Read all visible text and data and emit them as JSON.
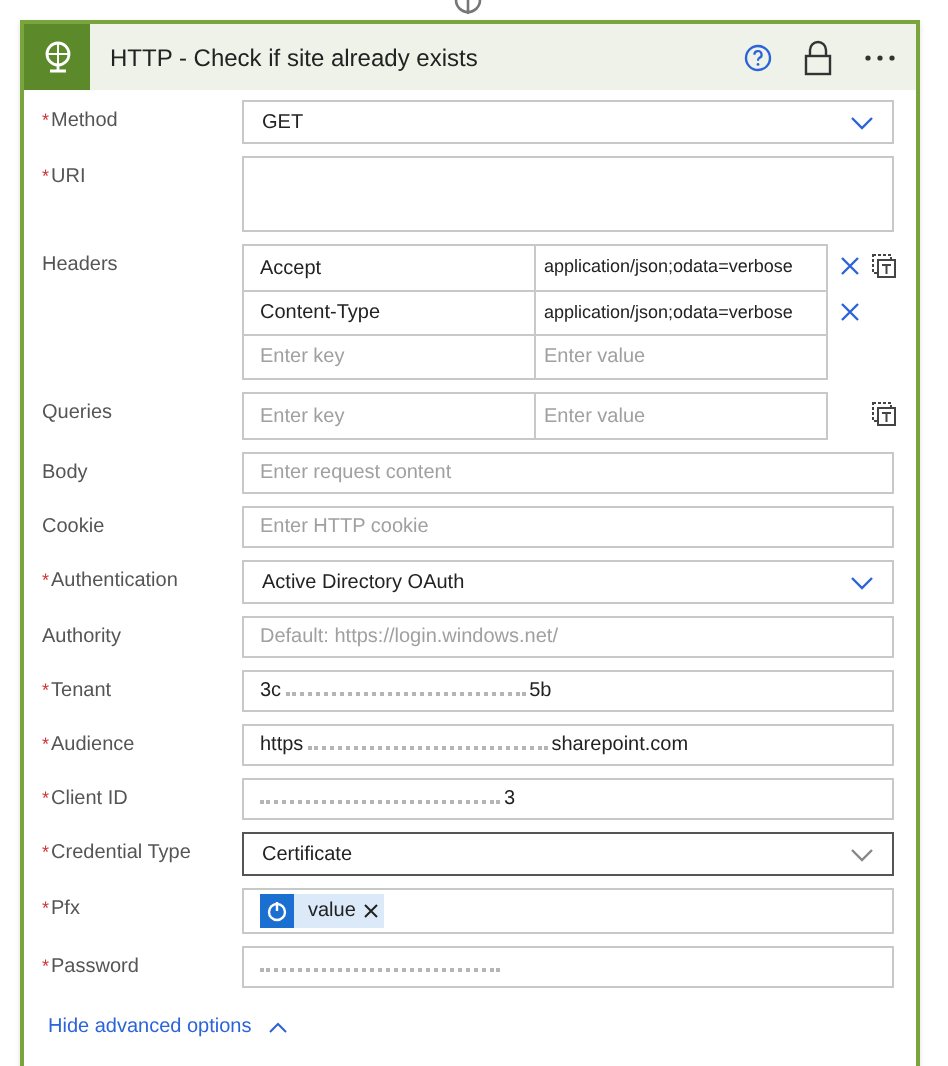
{
  "card": {
    "title": "HTTP - Check if site already exists"
  },
  "fields": [
    {
      "label": "Method",
      "required_mark": "*",
      "kind": "select",
      "focused": false,
      "value": "GET"
    },
    {
      "label": "URI",
      "required_mark": "*",
      "kind": "textarea",
      "focused": false
    },
    {
      "label": "Headers",
      "kind": "table",
      "focused": false,
      "rows": [
        {
          "key": "Accept",
          "value": "application/json;odata=verbose"
        },
        {
          "key": "Content-Type",
          "value": "application/json;odata=verbose"
        },
        {
          "key_placeholder": "Enter key",
          "value_placeholder": "Enter value"
        }
      ]
    },
    {
      "label": "Queries",
      "kind": "table",
      "focused": false,
      "rows": [
        {
          "key_placeholder": "Enter key",
          "value_placeholder": "Enter value"
        }
      ]
    },
    {
      "label": "Body",
      "kind": "text",
      "focused": false,
      "placeholder": "Enter request content"
    },
    {
      "label": "Cookie",
      "kind": "text",
      "focused": false,
      "placeholder": "Enter HTTP cookie"
    },
    {
      "label": "Authentication",
      "required_mark": "*",
      "kind": "select",
      "focused": false,
      "value": "Active Directory OAuth"
    },
    {
      "label": "Authority",
      "kind": "text",
      "focused": false,
      "placeholder": "Default: https://login.windows.net/"
    },
    {
      "label": "Tenant",
      "required_mark": "*",
      "kind": "redacted",
      "focused": false,
      "parts": [
        {
          "kind": "text",
          "text": "3c"
        },
        {
          "kind": "blur"
        },
        {
          "kind": "text",
          "text": "5b"
        }
      ]
    },
    {
      "label": "Audience",
      "required_mark": "*",
      "kind": "redacted",
      "focused": false,
      "parts": [
        {
          "kind": "text",
          "text": "https"
        },
        {
          "kind": "blur"
        },
        {
          "kind": "text",
          "text": "sharepoint.com"
        }
      ]
    },
    {
      "label": "Client ID",
      "required_mark": "*",
      "kind": "redacted",
      "focused": false,
      "parts": [
        {
          "kind": "blur"
        },
        {
          "kind": "text",
          "text": "3"
        }
      ]
    },
    {
      "label": "Credential Type",
      "required_mark": "*",
      "kind": "select",
      "focused": true,
      "value": "Certificate"
    },
    {
      "label": "Pfx",
      "required_mark": "*",
      "kind": "token",
      "focused": false,
      "token": "value"
    },
    {
      "label": "Password",
      "required_mark": "*",
      "kind": "redacted",
      "focused": false,
      "parts": [
        {
          "kind": "blur"
        }
      ]
    }
  ],
  "advanced_link": "Hide advanced options"
}
